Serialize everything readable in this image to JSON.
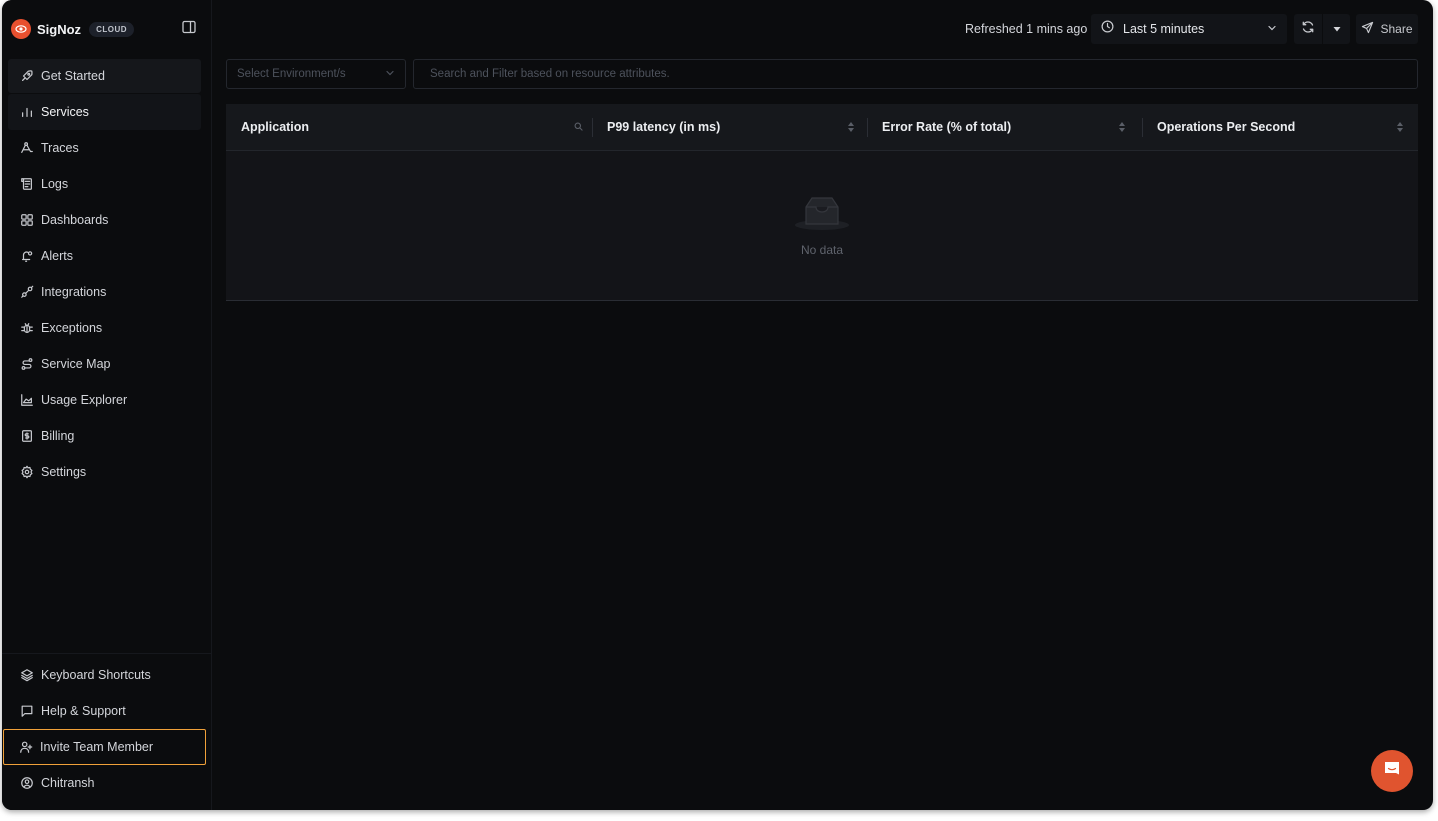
{
  "app": {
    "brand_name": "SigNoz",
    "brand_badge": "CLOUD",
    "accent_color": "#e8502f"
  },
  "sidebar": {
    "items": [
      {
        "label": "Get Started",
        "icon": "rocket-icon"
      },
      {
        "label": "Services",
        "icon": "bar-chart-icon",
        "active": true
      },
      {
        "label": "Traces",
        "icon": "traces-icon"
      },
      {
        "label": "Logs",
        "icon": "scroll-icon"
      },
      {
        "label": "Dashboards",
        "icon": "grid-icon"
      },
      {
        "label": "Alerts",
        "icon": "bell-icon"
      },
      {
        "label": "Integrations",
        "icon": "plug-icon"
      },
      {
        "label": "Exceptions",
        "icon": "bug-icon"
      },
      {
        "label": "Service Map",
        "icon": "route-icon"
      },
      {
        "label": "Usage Explorer",
        "icon": "area-chart-icon"
      },
      {
        "label": "Billing",
        "icon": "receipt-dollar-icon"
      },
      {
        "label": "Settings",
        "icon": "gear-icon"
      }
    ],
    "bottom_items": [
      {
        "label": "Keyboard Shortcuts",
        "icon": "layers-icon"
      },
      {
        "label": "Help & Support",
        "icon": "message-square-icon"
      },
      {
        "label": "Invite Team Member",
        "icon": "user-plus-icon",
        "highlighted": true
      },
      {
        "label": "Chitransh",
        "icon": "user-circle-icon"
      }
    ]
  },
  "topbar": {
    "refreshed_text": "Refreshed 1 mins ago",
    "time_range": "Last 5 minutes",
    "share_label": "Share"
  },
  "filters": {
    "environment_placeholder": "Select Environment/s",
    "search_placeholder": "Search and Filter based on resource attributes."
  },
  "table": {
    "columns": [
      {
        "label": "Application",
        "control": "search"
      },
      {
        "label": "P99 latency (in ms)",
        "control": "sort"
      },
      {
        "label": "Error Rate (% of total)",
        "control": "sort"
      },
      {
        "label": "Operations Per Second",
        "control": "sort"
      }
    ],
    "rows": [],
    "empty_text": "No data"
  }
}
